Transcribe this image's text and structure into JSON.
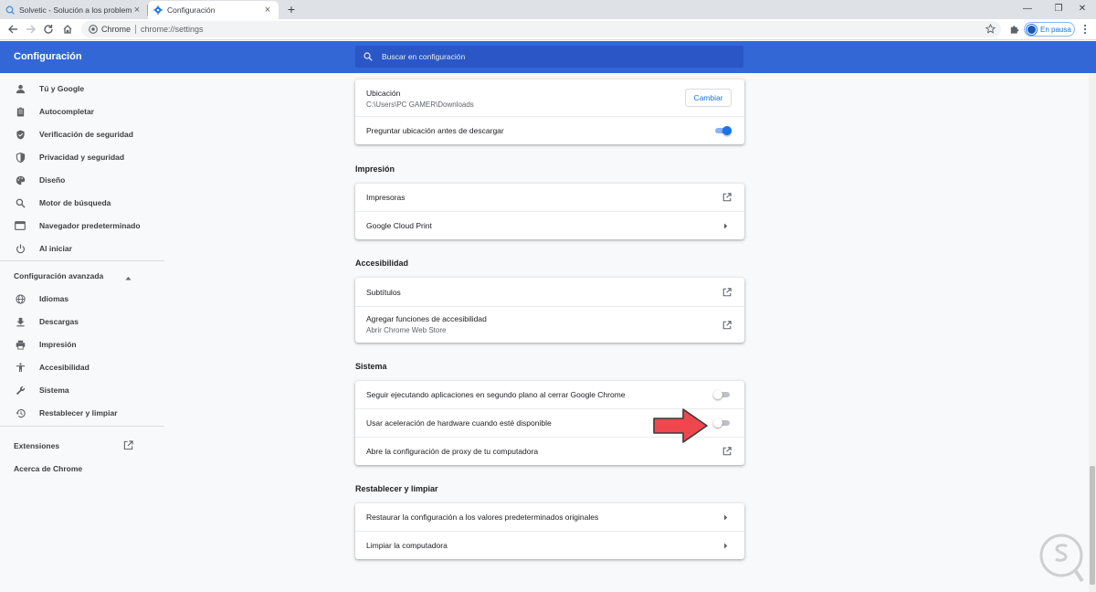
{
  "browser": {
    "tabs": [
      {
        "title": "Solvetic - Solución a los problem",
        "active": false,
        "icon": "solvetic-favicon"
      },
      {
        "title": "Configuración",
        "active": true,
        "icon": "gear-icon"
      }
    ],
    "omnibox": {
      "chip": "Chrome",
      "url": "chrome://settings"
    },
    "profile_label": "En pausa"
  },
  "header": {
    "title": "Configuración",
    "search_placeholder": "Buscar en configuración"
  },
  "sidebar": {
    "items": [
      {
        "label": "Tú y Google",
        "icon": "person-icon"
      },
      {
        "label": "Autocompletar",
        "icon": "clipboard-icon"
      },
      {
        "label": "Verificación de seguridad",
        "icon": "shield-check-icon"
      },
      {
        "label": "Privacidad y seguridad",
        "icon": "shield-half-icon"
      },
      {
        "label": "Diseño",
        "icon": "palette-icon"
      },
      {
        "label": "Motor de búsqueda",
        "icon": "search-icon"
      },
      {
        "label": "Navegador predeterminado",
        "icon": "browser-window-icon"
      },
      {
        "label": "Al iniciar",
        "icon": "power-icon"
      }
    ],
    "advanced_label": "Configuración avanzada",
    "advanced_items": [
      {
        "label": "Idiomas",
        "icon": "globe-icon"
      },
      {
        "label": "Descargas",
        "icon": "download-icon"
      },
      {
        "label": "Impresión",
        "icon": "printer-icon"
      },
      {
        "label": "Accesibilidad",
        "icon": "accessibility-icon"
      },
      {
        "label": "Sistema",
        "icon": "wrench-icon"
      },
      {
        "label": "Restablecer y limpiar",
        "icon": "history-icon"
      }
    ],
    "extensions_label": "Extensiones",
    "about_label": "Acerca de Chrome"
  },
  "downloads": {
    "location_label": "Ubicación",
    "location_path": "C:\\Users\\PC GAMER\\Downloads",
    "change_button": "Cambiar",
    "ask_label": "Preguntar ubicación antes de descargar",
    "ask_enabled": true
  },
  "printing": {
    "title": "Impresión",
    "printers_label": "Impresoras",
    "cloud_print_label": "Google Cloud Print"
  },
  "accessibility": {
    "title": "Accesibilidad",
    "captions_label": "Subtítulos",
    "add_features_label": "Agregar funciones de accesibilidad",
    "add_features_sub": "Abrir Chrome Web Store"
  },
  "system": {
    "title": "Sistema",
    "background_apps_label": "Seguir ejecutando aplicaciones en segundo plano al cerrar Google Chrome",
    "background_apps_enabled": false,
    "hardware_accel_label": "Usar aceleración de hardware cuando esté disponible",
    "hardware_accel_enabled": false,
    "proxy_label": "Abre la configuración de proxy de tu computadora"
  },
  "reset": {
    "title": "Restablecer y limpiar",
    "restore_label": "Restaurar la configuración a los valores predeterminados originales",
    "cleanup_label": "Limpiar la computadora"
  },
  "colors": {
    "header": "#3367d6",
    "accent": "#1a73e8",
    "annotation_arrow": "#f0474f"
  }
}
